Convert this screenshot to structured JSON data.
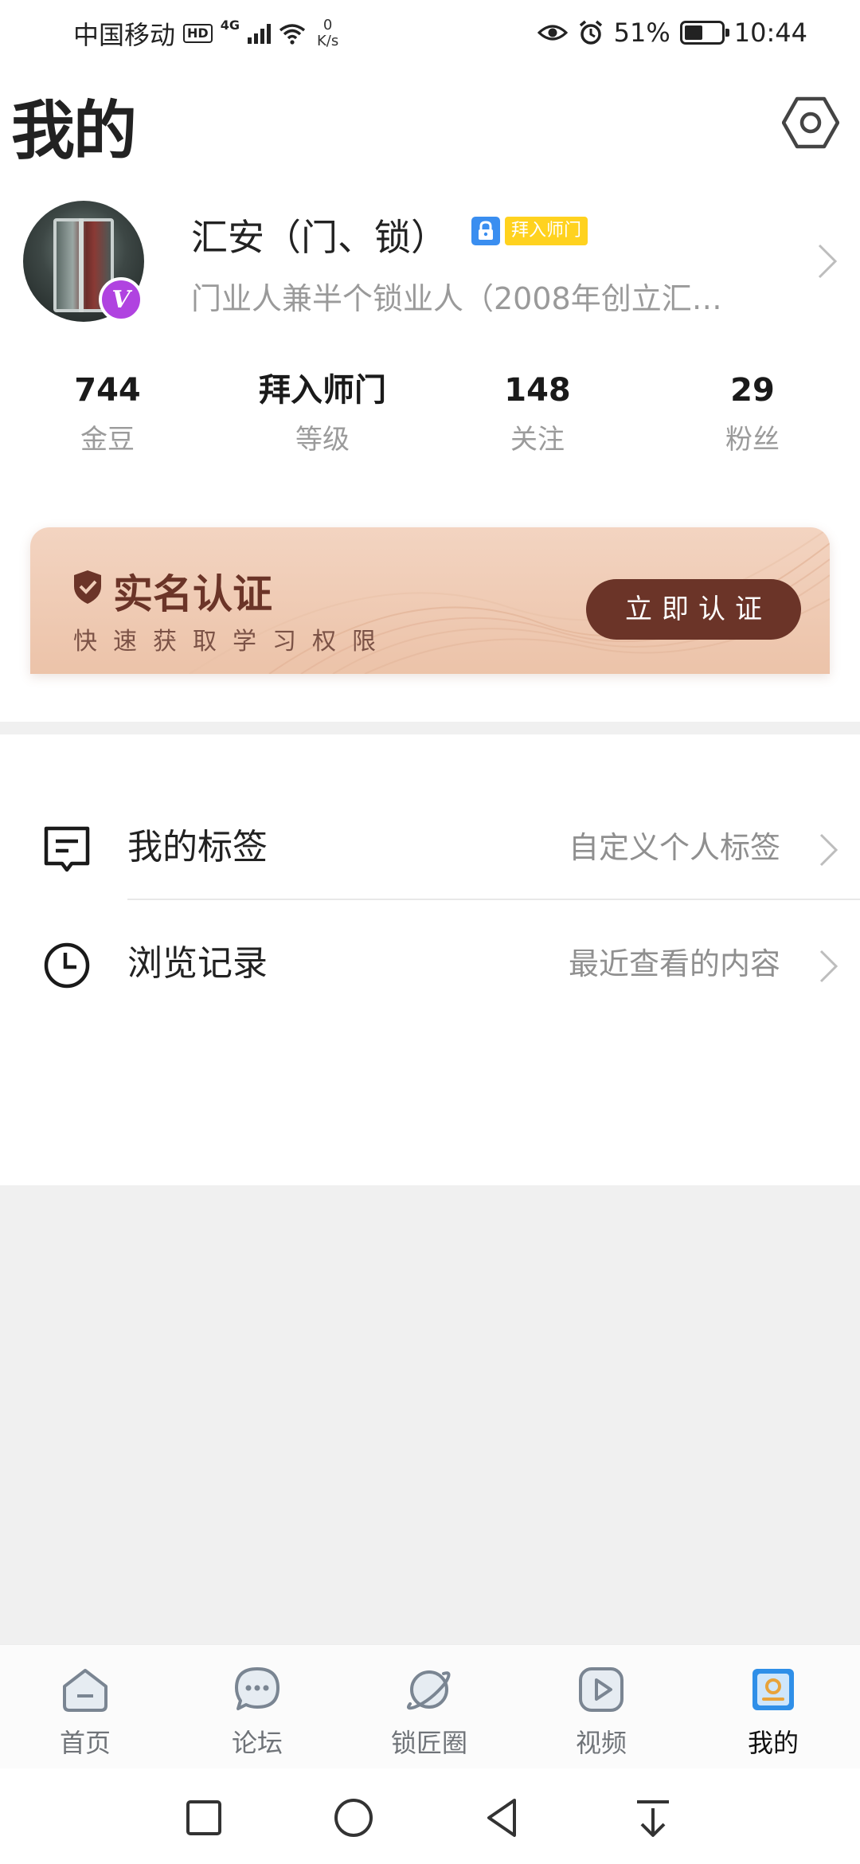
{
  "status_bar": {
    "carrier": "中国移动",
    "hd": "HD",
    "network": "4G",
    "speed_value": "0",
    "speed_unit": "K/s",
    "battery_percent": "51%",
    "battery_level": 0.51,
    "time": "10:44"
  },
  "header": {
    "title": "我的"
  },
  "profile": {
    "name": "汇安（门、锁）",
    "level_badge": "拜入师门",
    "bio": "门业人兼半个锁业人（2008年创立汇…",
    "verified_mark": "V"
  },
  "stats": [
    {
      "value": "744",
      "label": "金豆"
    },
    {
      "value": "拜入师门",
      "label": "等级"
    },
    {
      "value": "148",
      "label": "关注"
    },
    {
      "value": "29",
      "label": "粉丝"
    }
  ],
  "verify_card": {
    "title": "实名认证",
    "subtitle": "快速获取学习权限",
    "button": "立即认证"
  },
  "menu": [
    {
      "label": "我的标签",
      "hint": "自定义个人标签",
      "icon": "tag-icon"
    },
    {
      "label": "浏览记录",
      "hint": "最近查看的内容",
      "icon": "clock-icon"
    }
  ],
  "bottom_nav": [
    {
      "label": "首页",
      "icon": "home-icon",
      "active": false
    },
    {
      "label": "论坛",
      "icon": "chat-bubble-icon",
      "active": false
    },
    {
      "label": "锁匠圈",
      "icon": "planet-icon",
      "active": false
    },
    {
      "label": "视频",
      "icon": "play-icon",
      "active": false
    },
    {
      "label": "我的",
      "icon": "profile-icon",
      "active": true
    }
  ],
  "colors": {
    "accent_brown": "#6b3428",
    "card_peach": "#f3d4c1",
    "vip_purple": "#b043e0",
    "badge_yellow": "#ffd21f",
    "badge_blue": "#3a8ef0",
    "nav_active_blue": "#2f8fe8"
  }
}
